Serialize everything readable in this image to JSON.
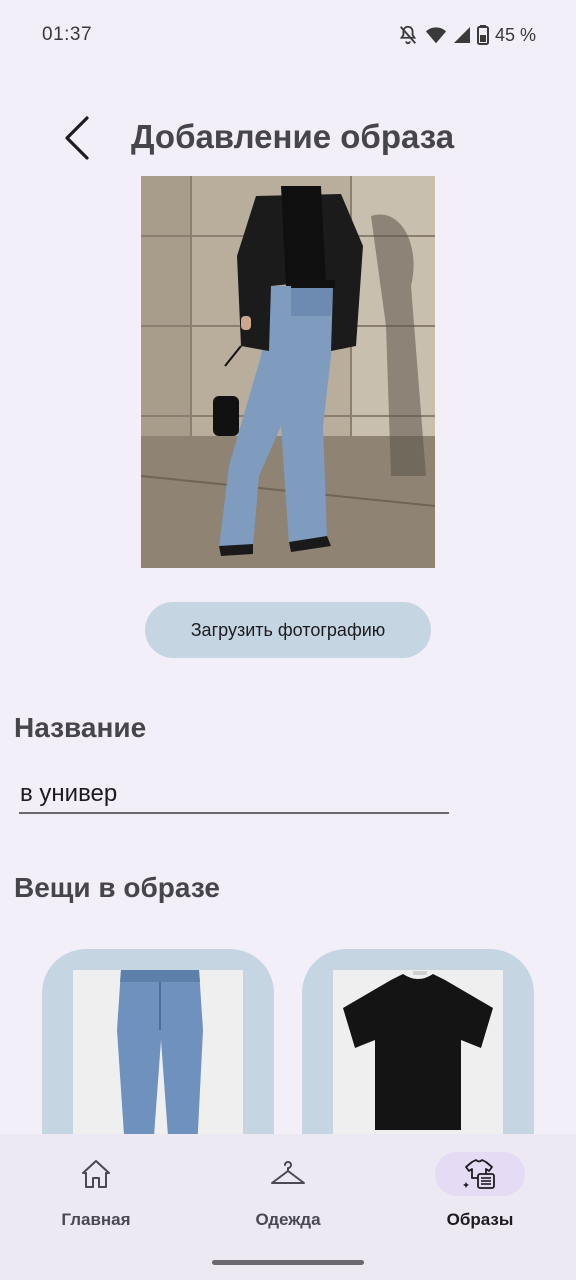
{
  "status_bar": {
    "time": "01:37",
    "battery_percent": "45 %",
    "icons": [
      "mute-icon",
      "wifi-icon",
      "signal-icon",
      "battery-icon"
    ]
  },
  "header": {
    "title": "Добавление образа",
    "back_icon": "chevron-left-icon"
  },
  "upload_button": {
    "label": "Загрузить фотографию"
  },
  "name_section": {
    "label": "Название",
    "value": "в универ"
  },
  "items_section": {
    "label": "Вещи в образе",
    "items": [
      {
        "kind": "jeans-image"
      },
      {
        "kind": "tshirt-image"
      }
    ]
  },
  "bottom_nav": {
    "items": [
      {
        "label": "Главная",
        "icon": "home-icon",
        "active": false
      },
      {
        "label": "Одежда",
        "icon": "hanger-icon",
        "active": false
      },
      {
        "label": "Образы",
        "icon": "outfits-icon",
        "active": true
      }
    ]
  },
  "colors": {
    "background": "#f2eff8",
    "accent_button": "#c5d6e2",
    "nav_active_pill": "#e5dbf5",
    "nav_background": "#ece9f2"
  }
}
